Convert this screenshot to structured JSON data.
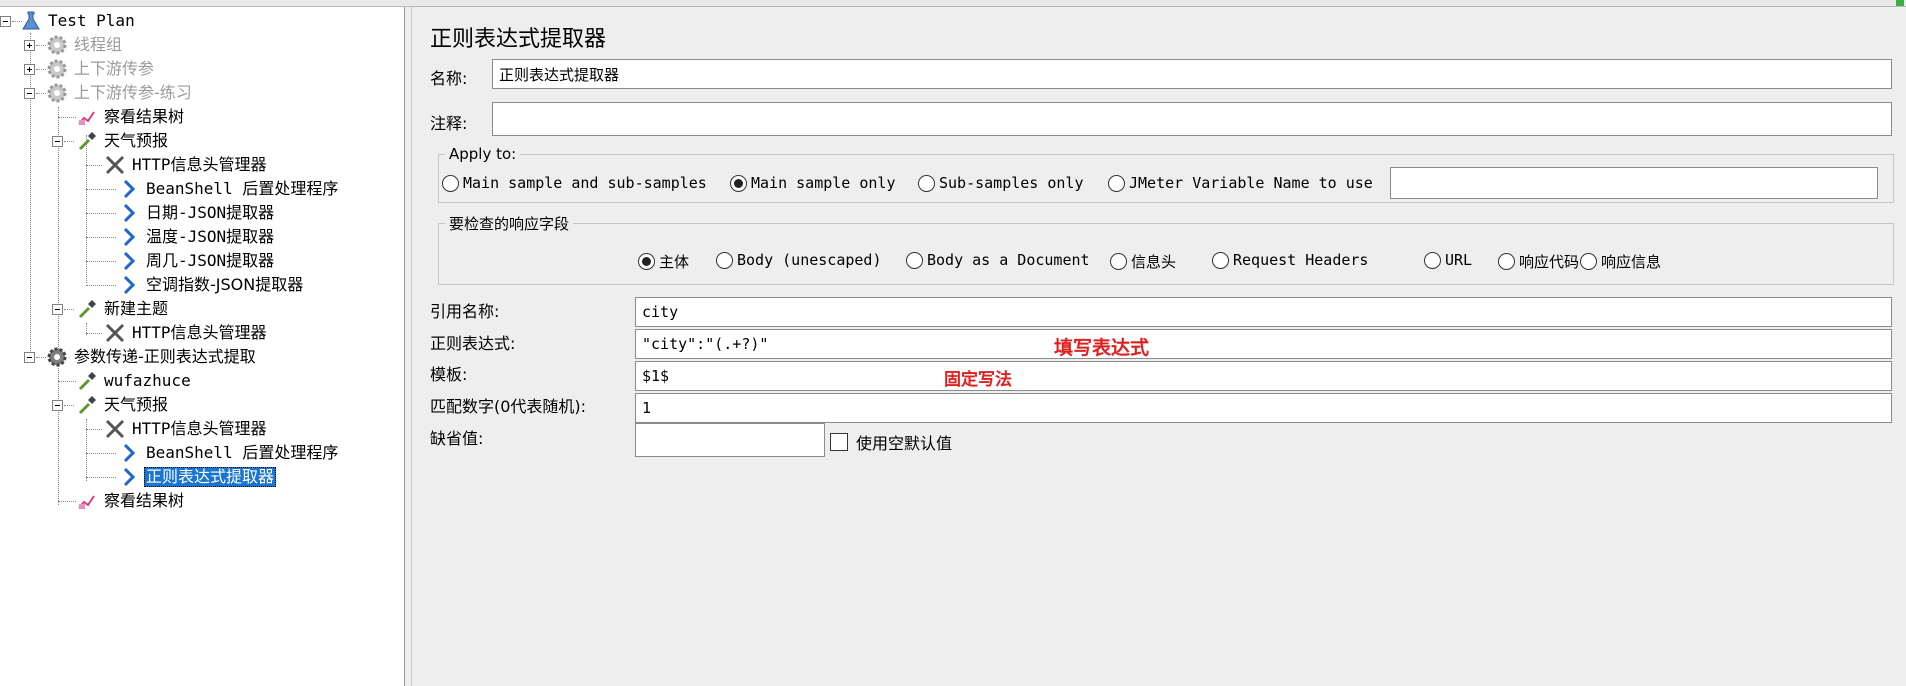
{
  "tree": {
    "items": [
      {
        "label": "Test Plan",
        "icon": "flask-icon",
        "disabled": false
      },
      {
        "label": "线程组",
        "icon": "gear-icon",
        "disabled": true
      },
      {
        "label": "上下游传参",
        "icon": "gear-icon",
        "disabled": true
      },
      {
        "label": "上下游传参-练习",
        "icon": "gear-icon",
        "disabled": true
      },
      {
        "label": "察看结果树",
        "icon": "chart-icon",
        "disabled": false
      },
      {
        "label": "天气预报",
        "icon": "pipette-icon",
        "disabled": false
      },
      {
        "label": "HTTP信息头管理器",
        "icon": "wrench-icon",
        "disabled": false
      },
      {
        "label": "BeanShell 后置处理程序",
        "icon": "arrow-icon",
        "disabled": false
      },
      {
        "label": "日期-JSON提取器",
        "icon": "arrow-icon",
        "disabled": false
      },
      {
        "label": "温度-JSON提取器",
        "icon": "arrow-icon",
        "disabled": false
      },
      {
        "label": "周几-JSON提取器",
        "icon": "arrow-icon",
        "disabled": false
      },
      {
        "label": "空调指数-JSON提取器",
        "icon": "arrow-icon",
        "disabled": false
      },
      {
        "label": "新建主题",
        "icon": "pipette-icon",
        "disabled": false
      },
      {
        "label": "HTTP信息头管理器",
        "icon": "wrench-icon",
        "disabled": false
      },
      {
        "label": "参数传递-正则表达式提取",
        "icon": "gear-icon",
        "disabled": false
      },
      {
        "label": "wufazhuce",
        "icon": "pipette-icon",
        "disabled": false
      },
      {
        "label": "天气预报",
        "icon": "pipette-icon",
        "disabled": false
      },
      {
        "label": "HTTP信息头管理器",
        "icon": "wrench-icon",
        "disabled": false
      },
      {
        "label": "BeanShell 后置处理程序",
        "icon": "arrow-icon",
        "disabled": false
      },
      {
        "label": "正则表达式提取器",
        "icon": "arrow-icon",
        "disabled": false,
        "selected": true
      },
      {
        "label": "察看结果树",
        "icon": "chart-icon",
        "disabled": false
      }
    ]
  },
  "editor": {
    "title": "正则表达式提取器",
    "name_label": "名称:",
    "name_value": "正则表达式提取器",
    "comment_label": "注释:",
    "comment_value": "",
    "apply_to": {
      "legend": "Apply to:",
      "options": [
        "Main sample and sub-samples",
        "Main sample only",
        "Sub-samples only",
        "JMeter Variable Name to use"
      ],
      "selected": "Main sample only",
      "variable_value": ""
    },
    "field_to_check": {
      "legend": "要检查的响应字段",
      "options": [
        "主体",
        "Body (unescaped)",
        "Body as a Document",
        "信息头",
        "Request Headers",
        "URL",
        "响应代码",
        "响应信息"
      ],
      "selected": "主体"
    },
    "ref_name_label": "引用名称:",
    "ref_name_value": "city",
    "regex_label": "正则表达式:",
    "regex_value": "\"city\":\"(.+?)\"",
    "template_label": "模板:",
    "template_value": "$1$",
    "match_no_label": "匹配数字(0代表随机):",
    "match_no_value": "1",
    "default_label": "缺省值:",
    "default_value": "",
    "use_empty_label": "使用空默认值",
    "use_empty_checked": false
  },
  "annotations": {
    "regex_note": "填写表达式",
    "template_note": "固定写法"
  },
  "colors": {
    "selection": "#1a75d2",
    "annotation": "#e02020",
    "panel_bg": "#eeeeee"
  }
}
